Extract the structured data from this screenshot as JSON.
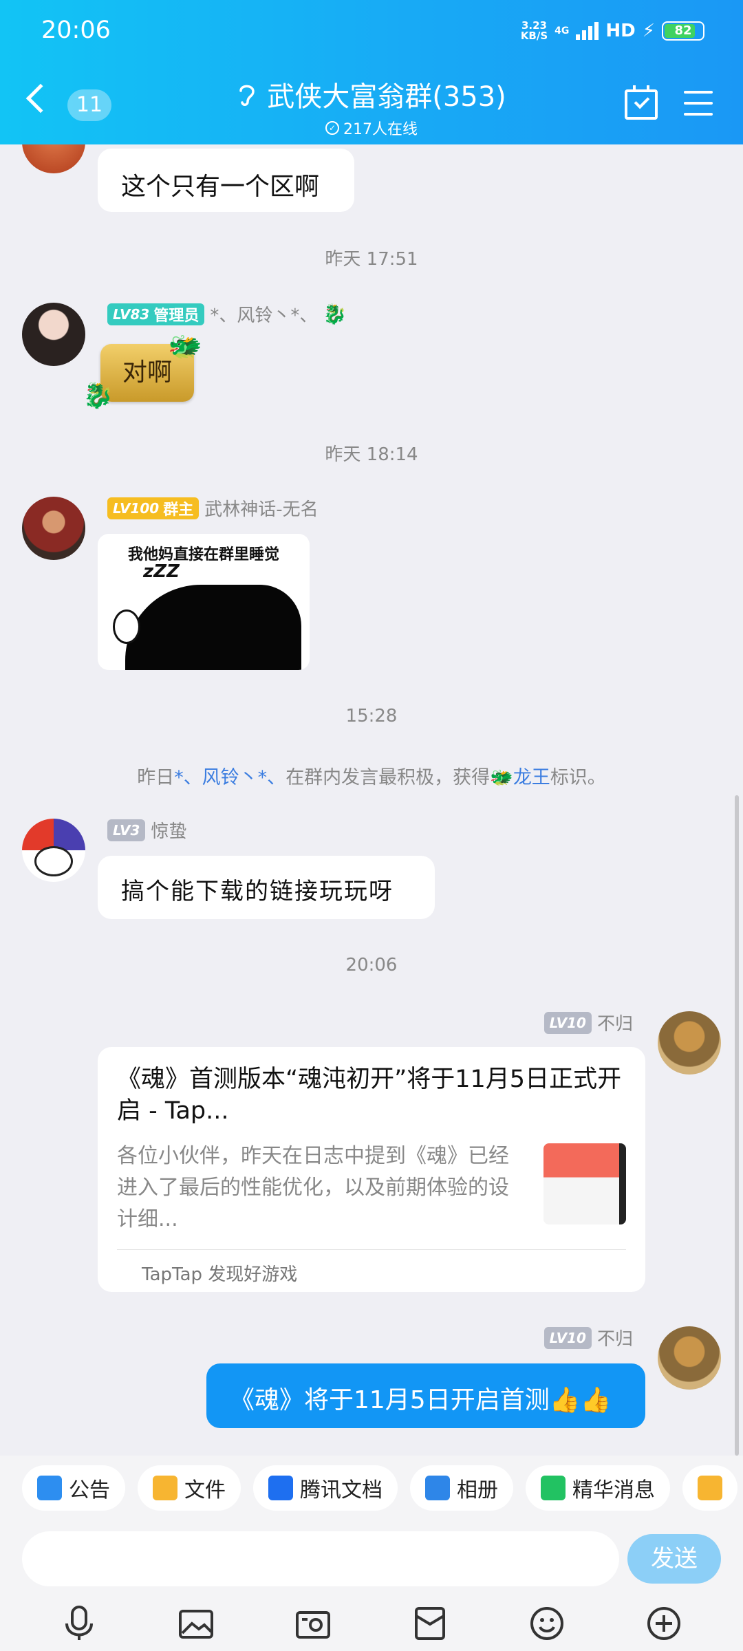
{
  "status_bar": {
    "time": "20:06",
    "net_speed_value": "3.23",
    "net_speed_unit": "KB/S",
    "network": "4G",
    "hd": "HD",
    "battery": "82"
  },
  "header": {
    "unread_count": "11",
    "title": "武侠大富翁群(353)",
    "online": "217人在线"
  },
  "messages": {
    "m1_text": "这个只有一个区啊",
    "t1": "昨天 17:51",
    "m2": {
      "level": "LV83",
      "role": "管理员",
      "name": "*、风铃丶*、",
      "text": "对啊"
    },
    "t2": "昨天 18:14",
    "m3": {
      "level": "LV100",
      "role": "群主",
      "name": "武林神话-无名",
      "sticker_caption": "我他妈直接在群里睡觉",
      "sticker_zzz": "zZZ"
    },
    "t3": "15:28",
    "system": {
      "p1": "昨日",
      "link1": "*、风铃丶*、",
      "p2": "在群内发言最积极，获得",
      "link2": "龙王",
      "p3": "标识。"
    },
    "m4": {
      "level": "LV3",
      "name": "惊蛰",
      "text": "搞个能下载的链接玩玩呀"
    },
    "t4": "20:06",
    "m5": {
      "level": "LV10",
      "name": "不归",
      "card_title": "《魂》首测版本“魂沌初开”将于11月5日正式开启 - Tap...",
      "card_desc": "各位小伙伴，昨天在日志中提到《魂》已经进入了最后的性能优化，以及前期体验的设计细...",
      "card_source": "TapTap 发现好游戏"
    },
    "m6": {
      "level": "LV10",
      "name": "不归",
      "text": "《魂》将于11月5日开启首测👍👍"
    }
  },
  "toolbar": [
    "公告",
    "文件",
    "腾讯文档",
    "相册",
    "精华消息"
  ],
  "input": {
    "send_label": "发送"
  },
  "colors": {
    "header_start": "#12c4f5",
    "header_end": "#1a98f5",
    "self_bubble": "#1296f5",
    "link": "#3b7de0",
    "admin_badge": "#34cbbf",
    "owner_badge": "#f6bd20"
  }
}
